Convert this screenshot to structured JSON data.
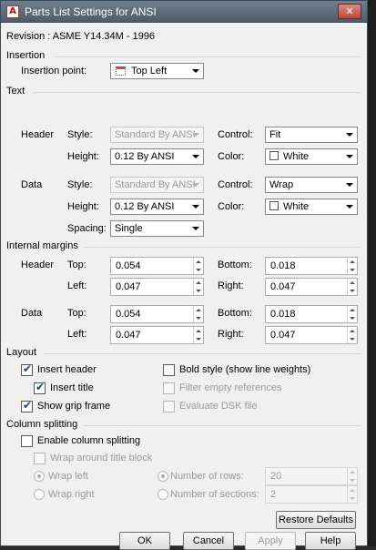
{
  "window": {
    "title": "Parts List Settings for ANSI",
    "close_glyph": "✕",
    "app_icon_glyph": "A"
  },
  "revision": "Revision : ASME Y14.34M - 1996",
  "insertion": {
    "section_label": "Insertion",
    "point_label": "Insertion point:",
    "point_value": "Top Left"
  },
  "text": {
    "section_label": "Text",
    "header_label": "Header",
    "data_label": "Data",
    "style_label": "Style:",
    "height_label": "Height:",
    "control_label": "Control:",
    "color_label": "Color:",
    "spacing_label": "Spacing:",
    "header": {
      "style": "Standard By ANSI",
      "height": "0.12 By ANSI",
      "control": "Fit",
      "color": "White"
    },
    "data": {
      "style": "Standard By ANSI",
      "height": "0.12 By ANSI",
      "control": "Wrap",
      "color": "White",
      "spacing": "Single"
    }
  },
  "margins": {
    "section_label": "Internal margins",
    "header_label": "Header",
    "data_label": "Data",
    "top_label": "Top:",
    "left_label": "Left:",
    "bottom_label": "Bottom:",
    "right_label": "Right:",
    "header": {
      "top": "0.054",
      "left": "0.047",
      "bottom": "0.018",
      "right": "0.047"
    },
    "data": {
      "top": "0.054",
      "left": "0.047",
      "bottom": "0.018",
      "right": "0.047"
    }
  },
  "layout": {
    "section_label": "Layout",
    "insert_header": "Insert header",
    "insert_title": "Insert title",
    "show_grip_frame": "Show grip frame",
    "bold_style": "Bold style (show line weights)",
    "filter_empty": "Filter empty references",
    "evaluate_dsk": "Evaluate DSK file",
    "check_glyph": "✔"
  },
  "column_splitting": {
    "section_label": "Column splitting",
    "enable": "Enable column splitting",
    "wrap_around": "Wrap around title block",
    "wrap_left": "Wrap left",
    "wrap_right": "Wrap right",
    "number_of_rows": "Number of rows:",
    "number_of_sections": "Number of sections:",
    "rows_value": "20",
    "sections_value": "2"
  },
  "buttons": {
    "restore_defaults": "Restore Defaults",
    "ok": "OK",
    "cancel": "Cancel",
    "apply": "Apply",
    "help": "Help"
  },
  "colors": {
    "titlebar": "#5c6b78",
    "dialog_bg": "#f0f0f0",
    "section_line": "#d5dadf",
    "disabled_text": "#9a9a9a"
  }
}
